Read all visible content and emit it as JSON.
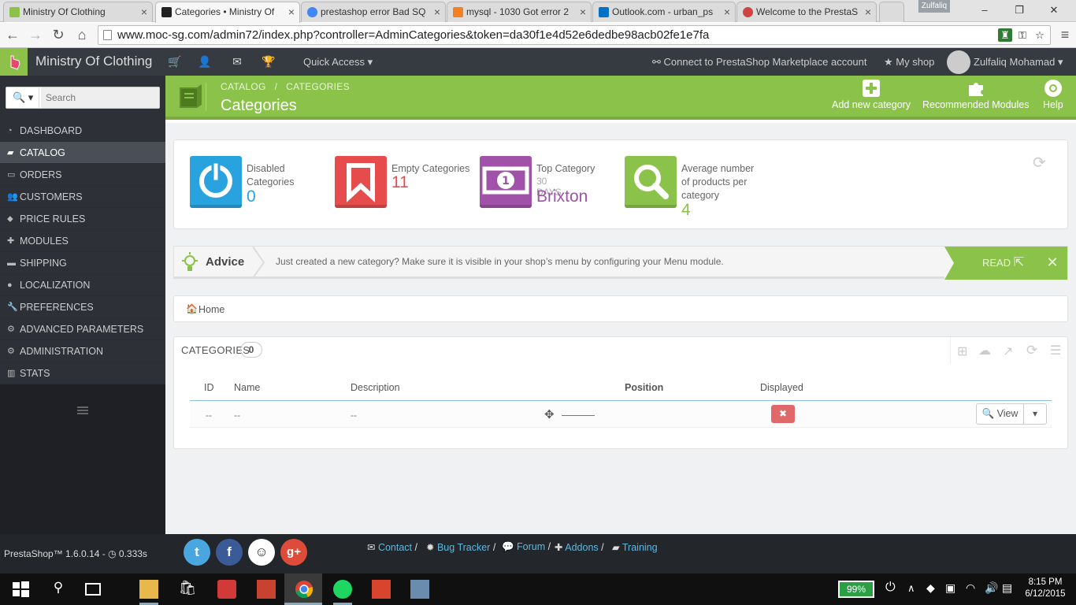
{
  "browser": {
    "tabs": [
      {
        "title": "Ministry Of Clothing",
        "fav": "#8bc34a"
      },
      {
        "title": "Categories • Ministry Of",
        "fav": "#222"
      },
      {
        "title": "prestashop error Bad SQ",
        "fav": "#4285f4"
      },
      {
        "title": "mysql - 1030 Got error 2",
        "fav": "#f48024"
      },
      {
        "title": "Outlook.com - urban_ps",
        "fav": "#0072c6"
      },
      {
        "title": "Welcome to the PrestaS",
        "fav": "#c44"
      }
    ],
    "profile": "Zulfaliq",
    "url": "www.moc-sg.com/admin72/index.php?controller=AdminCategories&token=da30f1e4d52e6dedbe98acb02fe1e7fa",
    "controls": {
      "minimize": "–",
      "maximize": "❐",
      "close": "✕"
    }
  },
  "header": {
    "shop_name": "Ministry Of Clothing",
    "quick_access": "Quick Access ▾",
    "marketplace": "Connect to PrestaShop Marketplace account",
    "my_shop": "My shop",
    "user": "Zulfaliq Mohamad"
  },
  "sidebar": {
    "search_placeholder": "Search",
    "items": [
      {
        "label": "DASHBOARD",
        "icon": "dashboard-icon"
      },
      {
        "label": "CATALOG",
        "icon": "book-icon"
      },
      {
        "label": "ORDERS",
        "icon": "credit-card-icon"
      },
      {
        "label": "CUSTOMERS",
        "icon": "users-icon"
      },
      {
        "label": "PRICE RULES",
        "icon": "tags-icon"
      },
      {
        "label": "MODULES",
        "icon": "puzzle-icon"
      },
      {
        "label": "SHIPPING",
        "icon": "truck-icon"
      },
      {
        "label": "LOCALIZATION",
        "icon": "globe-icon"
      },
      {
        "label": "PREFERENCES",
        "icon": "wrench-icon"
      },
      {
        "label": "ADVANCED PARAMETERS",
        "icon": "cogs-icon"
      },
      {
        "label": "ADMINISTRATION",
        "icon": "cog-icon"
      },
      {
        "label": "STATS",
        "icon": "bar-chart-icon"
      }
    ],
    "active_index": 1
  },
  "page": {
    "breadcrumb_catalog": "CATALOG",
    "breadcrumb_sep": "/",
    "breadcrumb_categories": "CATEGORIES",
    "title": "Categories",
    "toolbar": {
      "add_new": "Add new category",
      "recommended": "Recommended Modules",
      "help": "Help"
    }
  },
  "kpis": [
    {
      "label": "Disabled Categories",
      "value": "0",
      "color": "#29a3df",
      "value_color": "#29a3df"
    },
    {
      "label": "Empty Categories",
      "value": "11",
      "color": "#e74c4c",
      "value_color": "#e74c4c"
    },
    {
      "label": "Top Category",
      "sub": "30 DAYS",
      "value": "Brixton",
      "color": "#a052a8",
      "value_color": "#a052a8"
    },
    {
      "label": "Average number of products per category",
      "value": "4",
      "color": "#8bc34a",
      "value_color": "#8bc34a"
    }
  ],
  "advice": {
    "title": "Advice",
    "text": "Just created a new category? Make sure it is visible in your shop’s menu by configuring your Menu module.",
    "read": "READ",
    "close": "✕"
  },
  "home_crumb": "Home",
  "list": {
    "title": "CATEGORIES",
    "count": "0",
    "columns": {
      "id": "ID",
      "name": "Name",
      "description": "Description",
      "position": "Position",
      "displayed": "Displayed"
    },
    "row": {
      "id": "--",
      "name": "--",
      "description": "--",
      "view": "View",
      "dropdown": "▾",
      "displayed_icon": "✖"
    }
  },
  "footer": {
    "version": "PrestaShop™ 1.6.0.14 - ",
    "time": "0.333s",
    "links": [
      "Contact",
      "Bug Tracker",
      "Forum",
      "Addons",
      "Training"
    ],
    "separator": "/"
  },
  "taskbar": {
    "battery": "99%",
    "time": "8:15 PM",
    "date": "6/12/2015"
  }
}
